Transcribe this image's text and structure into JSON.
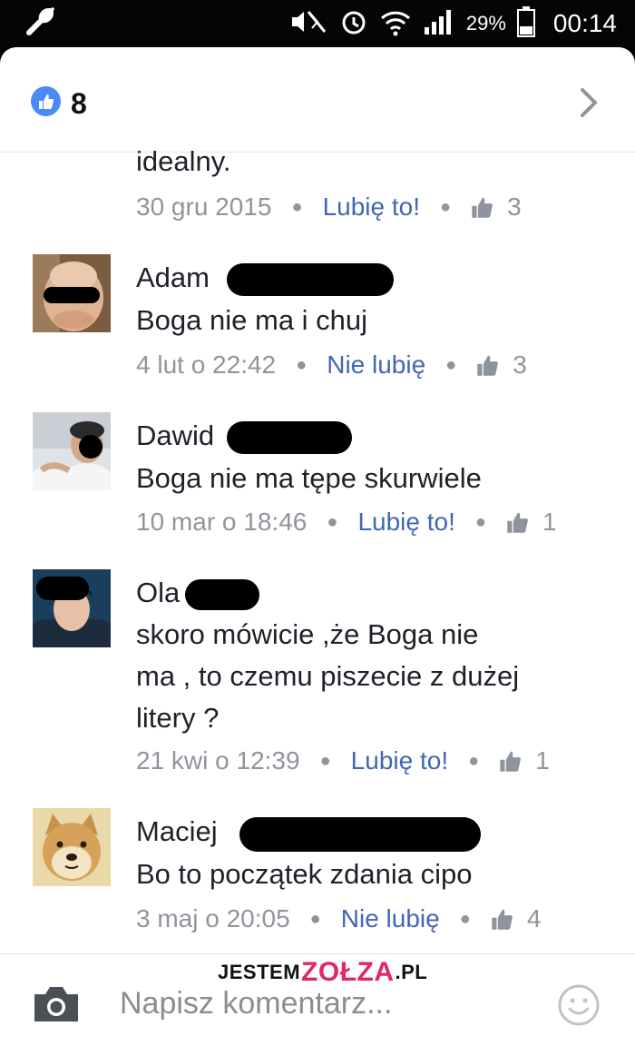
{
  "status_bar": {
    "battery": "29%",
    "time": "00:14",
    "icons": [
      "wrench-icon",
      "mute-icon",
      "alarm-icon",
      "wifi-icon",
      "signal-icon",
      "battery-icon"
    ]
  },
  "likes_header": {
    "count": "8",
    "icon": "thumbs-up-icon",
    "chevron": "chevron-right-icon"
  },
  "partial_comment": {
    "text": "idealny.",
    "date": "30 gru 2015",
    "action": "Lubię to!",
    "likes": "3"
  },
  "comments": [
    {
      "name": "Adam",
      "text": "Boga nie ma i chuj",
      "date": "4 lut o 22:42",
      "action": "Nie lubię",
      "likes": "3"
    },
    {
      "name": "Dawid",
      "text": "Boga nie ma tępe skurwiele",
      "date": "10 mar o 18:46",
      "action": "Lubię to!",
      "likes": "1"
    },
    {
      "name": "Ola",
      "text_lines": [
        "skoro mówicie ,że Boga nie",
        "ma , to czemu piszecie z dużej",
        "litery ?"
      ],
      "date": "21 kwi o 12:39",
      "action": "Lubię to!",
      "likes": "1"
    },
    {
      "name": "Maciej",
      "text": "Bo to początek zdania cipo",
      "date": "3 maj o 20:05",
      "action": "Nie lubię",
      "likes": "4"
    }
  ],
  "composer": {
    "placeholder": "Napisz komentarz...",
    "camera_icon": "camera-icon",
    "emoji_icon": "smiley-icon"
  },
  "watermark": {
    "part1": "JESTEM",
    "part2": "ZOŁZA",
    "part3": ".PL"
  },
  "colors": {
    "link": "#4267b2",
    "meta": "#90949c",
    "like_badge": "#4a8af4"
  }
}
